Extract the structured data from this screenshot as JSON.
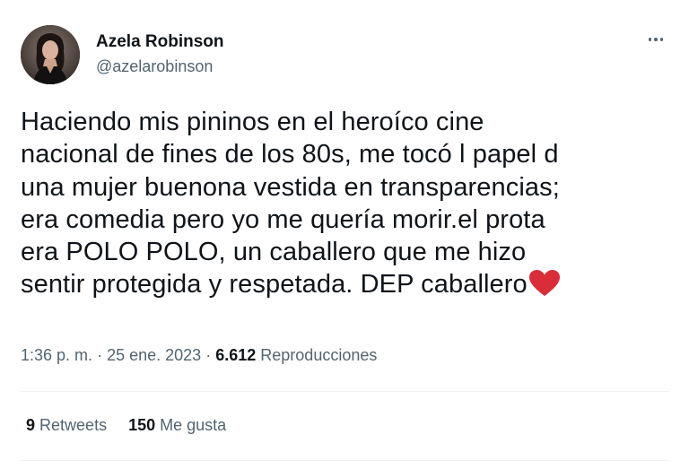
{
  "author": {
    "display_name": "Azela Robinson",
    "handle": "@azelarobinson"
  },
  "more_icon": "more-dots-icon",
  "tweet": {
    "lines": [
      "Haciendo mis pininos en el heroíco cine",
      "nacional de fines de los 80s, me tocó l papel d",
      "una mujer buenona vestida en transparencias;",
      "era comedia pero yo me quería morir.el prota",
      "era POLO POLO, un caballero que me hizo",
      "sentir protegida y respetada. DEP caballero"
    ],
    "emoji": "red-heart-icon",
    "heart_color": "#d92d3a"
  },
  "meta": {
    "time": "1:36 p. m.",
    "separator": "·",
    "date": "25 ene. 2023",
    "views_count": "6.612",
    "views_label": "Reproducciones"
  },
  "stats": {
    "retweets_count": "9",
    "retweets_label": "Retweets",
    "likes_count": "150",
    "likes_label": "Me gusta"
  },
  "colors": {
    "text_primary": "#0f1419",
    "text_secondary": "#536471",
    "divider": "#eff3f4"
  }
}
